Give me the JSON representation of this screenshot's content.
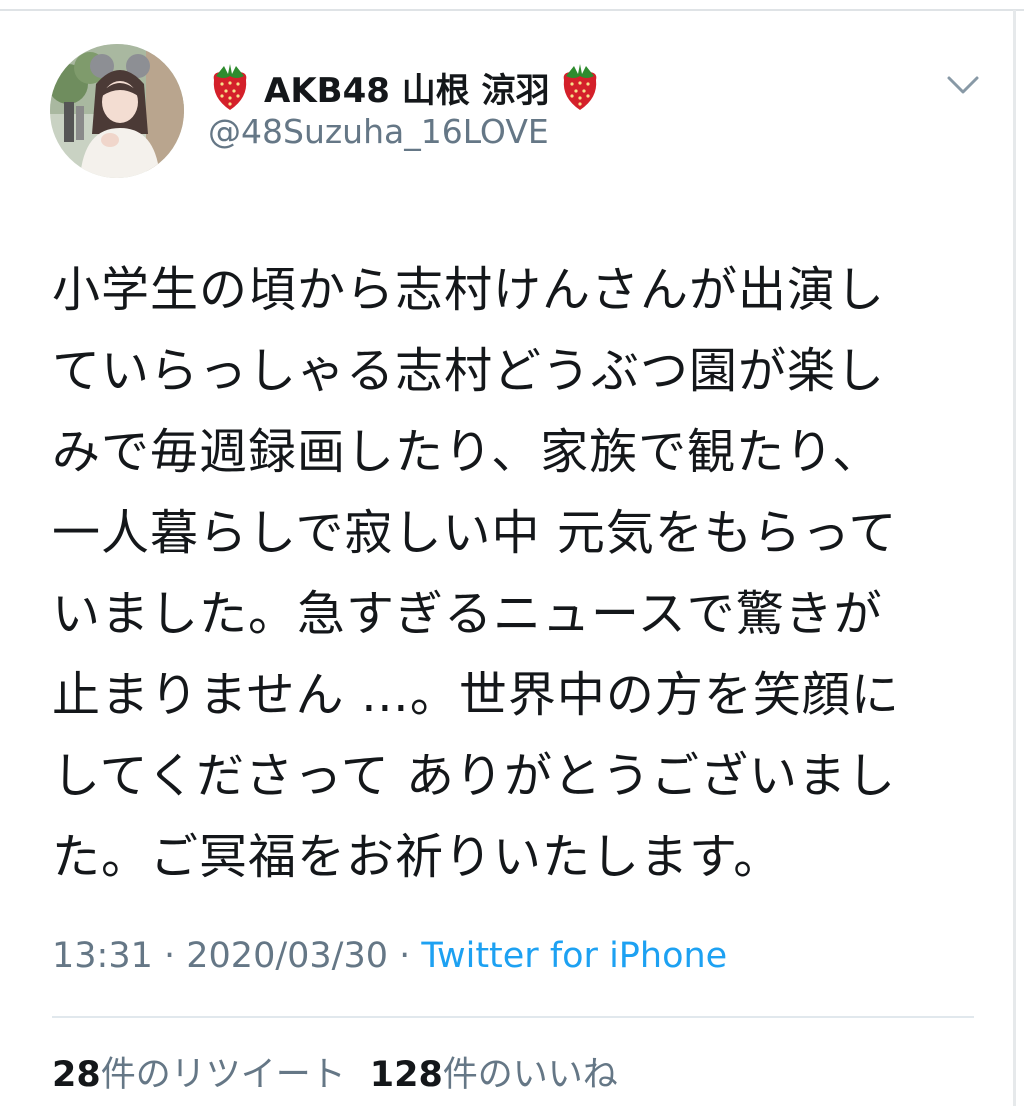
{
  "tweet": {
    "author": {
      "display_name": "AKB48 山根 涼羽",
      "handle": "@48Suzuha_16LOVE",
      "name_emoji": "strawberry-icon"
    },
    "text_lines": [
      "小学生の頃から志村けんさんが出演し",
      "ていらっしゃる志村どうぶつ園が楽し",
      "みで毎週録画したり、家族で観たり、",
      "一人暮らしで寂しい中 元気をもらって",
      "いました。急すぎるニュースで驚きが",
      "止まりません …。世界中の方を笑顔に",
      "してくださって ありがとうございまし",
      "た。ご冥福をお祈りいたします。"
    ],
    "time": "13:31",
    "separator": " · ",
    "date": "2020/03/30",
    "source": "Twitter for iPhone",
    "retweets": {
      "count": "28",
      "label": "件のリツイート"
    },
    "likes": {
      "count": "128",
      "label": "件のいいね"
    }
  },
  "colors": {
    "text_primary": "#14171a",
    "text_secondary": "#657786",
    "link": "#1da1f2",
    "divider": "#e1e8ed",
    "strawberry": "#d4202a"
  }
}
